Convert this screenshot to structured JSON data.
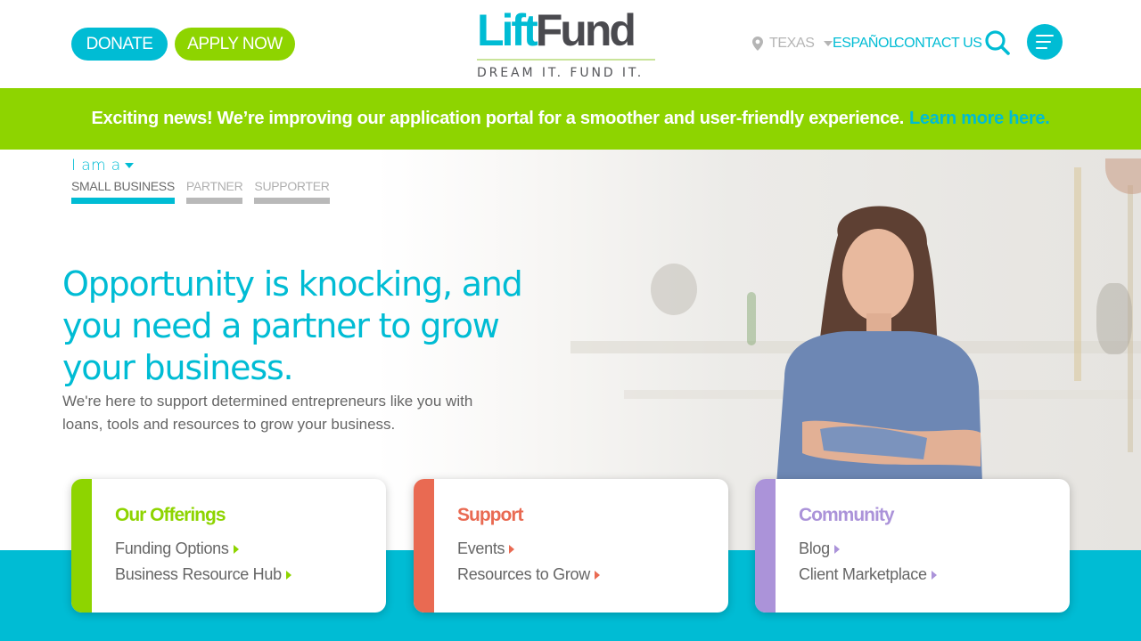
{
  "header": {
    "donate_label": "DONATE",
    "apply_label": "APPLY NOW",
    "logo": {
      "lift": "Lift",
      "fund": "Fund",
      "tagline": "DREAM IT. FUND IT."
    },
    "location": "TEXAS",
    "espanol_label": "ESPAÑOL",
    "contact_label": "CONTACT US"
  },
  "banner": {
    "text": "Exciting news! We’re improving our application portal for a smoother and user-friendly experience.",
    "link": "Learn more here."
  },
  "hero": {
    "i_am_a": "I am a",
    "tabs": [
      {
        "label": "SMALL BUSINESS",
        "active": true
      },
      {
        "label": "PARTNER",
        "active": false
      },
      {
        "label": "SUPPORTER",
        "active": false
      }
    ],
    "headline": "Opportunity is knocking, and you need a partner to grow your business.",
    "subhead": "We're here to support determined entrepreneurs like you with loans, tools and resources to grow your business."
  },
  "cards": [
    {
      "title": "Our Offerings",
      "color": "#8ed400",
      "links": [
        "Funding Options",
        "Business Resource Hub"
      ]
    },
    {
      "title": "Support",
      "color": "#e96a52",
      "links": [
        "Events",
        "Resources to Grow"
      ]
    },
    {
      "title": "Community",
      "color": "#ab93d9",
      "links": [
        "Blog",
        "Client Marketplace"
      ]
    }
  ],
  "colors": {
    "brand_blue": "#00bcd4",
    "brand_green": "#8ed400",
    "text_gray": "#666666"
  },
  "icons": [
    "map-pin-icon",
    "caret-down-icon",
    "search-icon",
    "hamburger-menu-icon",
    "arrow-right-icon"
  ]
}
